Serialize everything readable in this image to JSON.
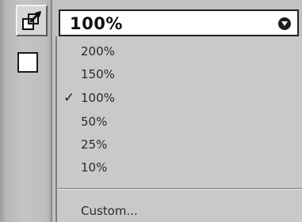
{
  "toolbar": {
    "tools": [
      {
        "name": "transform-tool",
        "icon": "transform-arrow-icon"
      },
      {
        "name": "fill-swatch",
        "icon": "white-swatch"
      }
    ]
  },
  "zoom": {
    "current_value": "100%",
    "options": [
      {
        "label": "200%",
        "checked": false
      },
      {
        "label": "150%",
        "checked": false
      },
      {
        "label": "100%",
        "checked": true
      },
      {
        "label": "50%",
        "checked": false
      },
      {
        "label": "25%",
        "checked": false
      },
      {
        "label": "10%",
        "checked": false
      }
    ],
    "custom_label": "Custom...",
    "check_mark": "✓"
  },
  "colors": {
    "panel": "#c2c2c2",
    "combo_bg": "#ffffff",
    "text": "#2a2a2a"
  }
}
